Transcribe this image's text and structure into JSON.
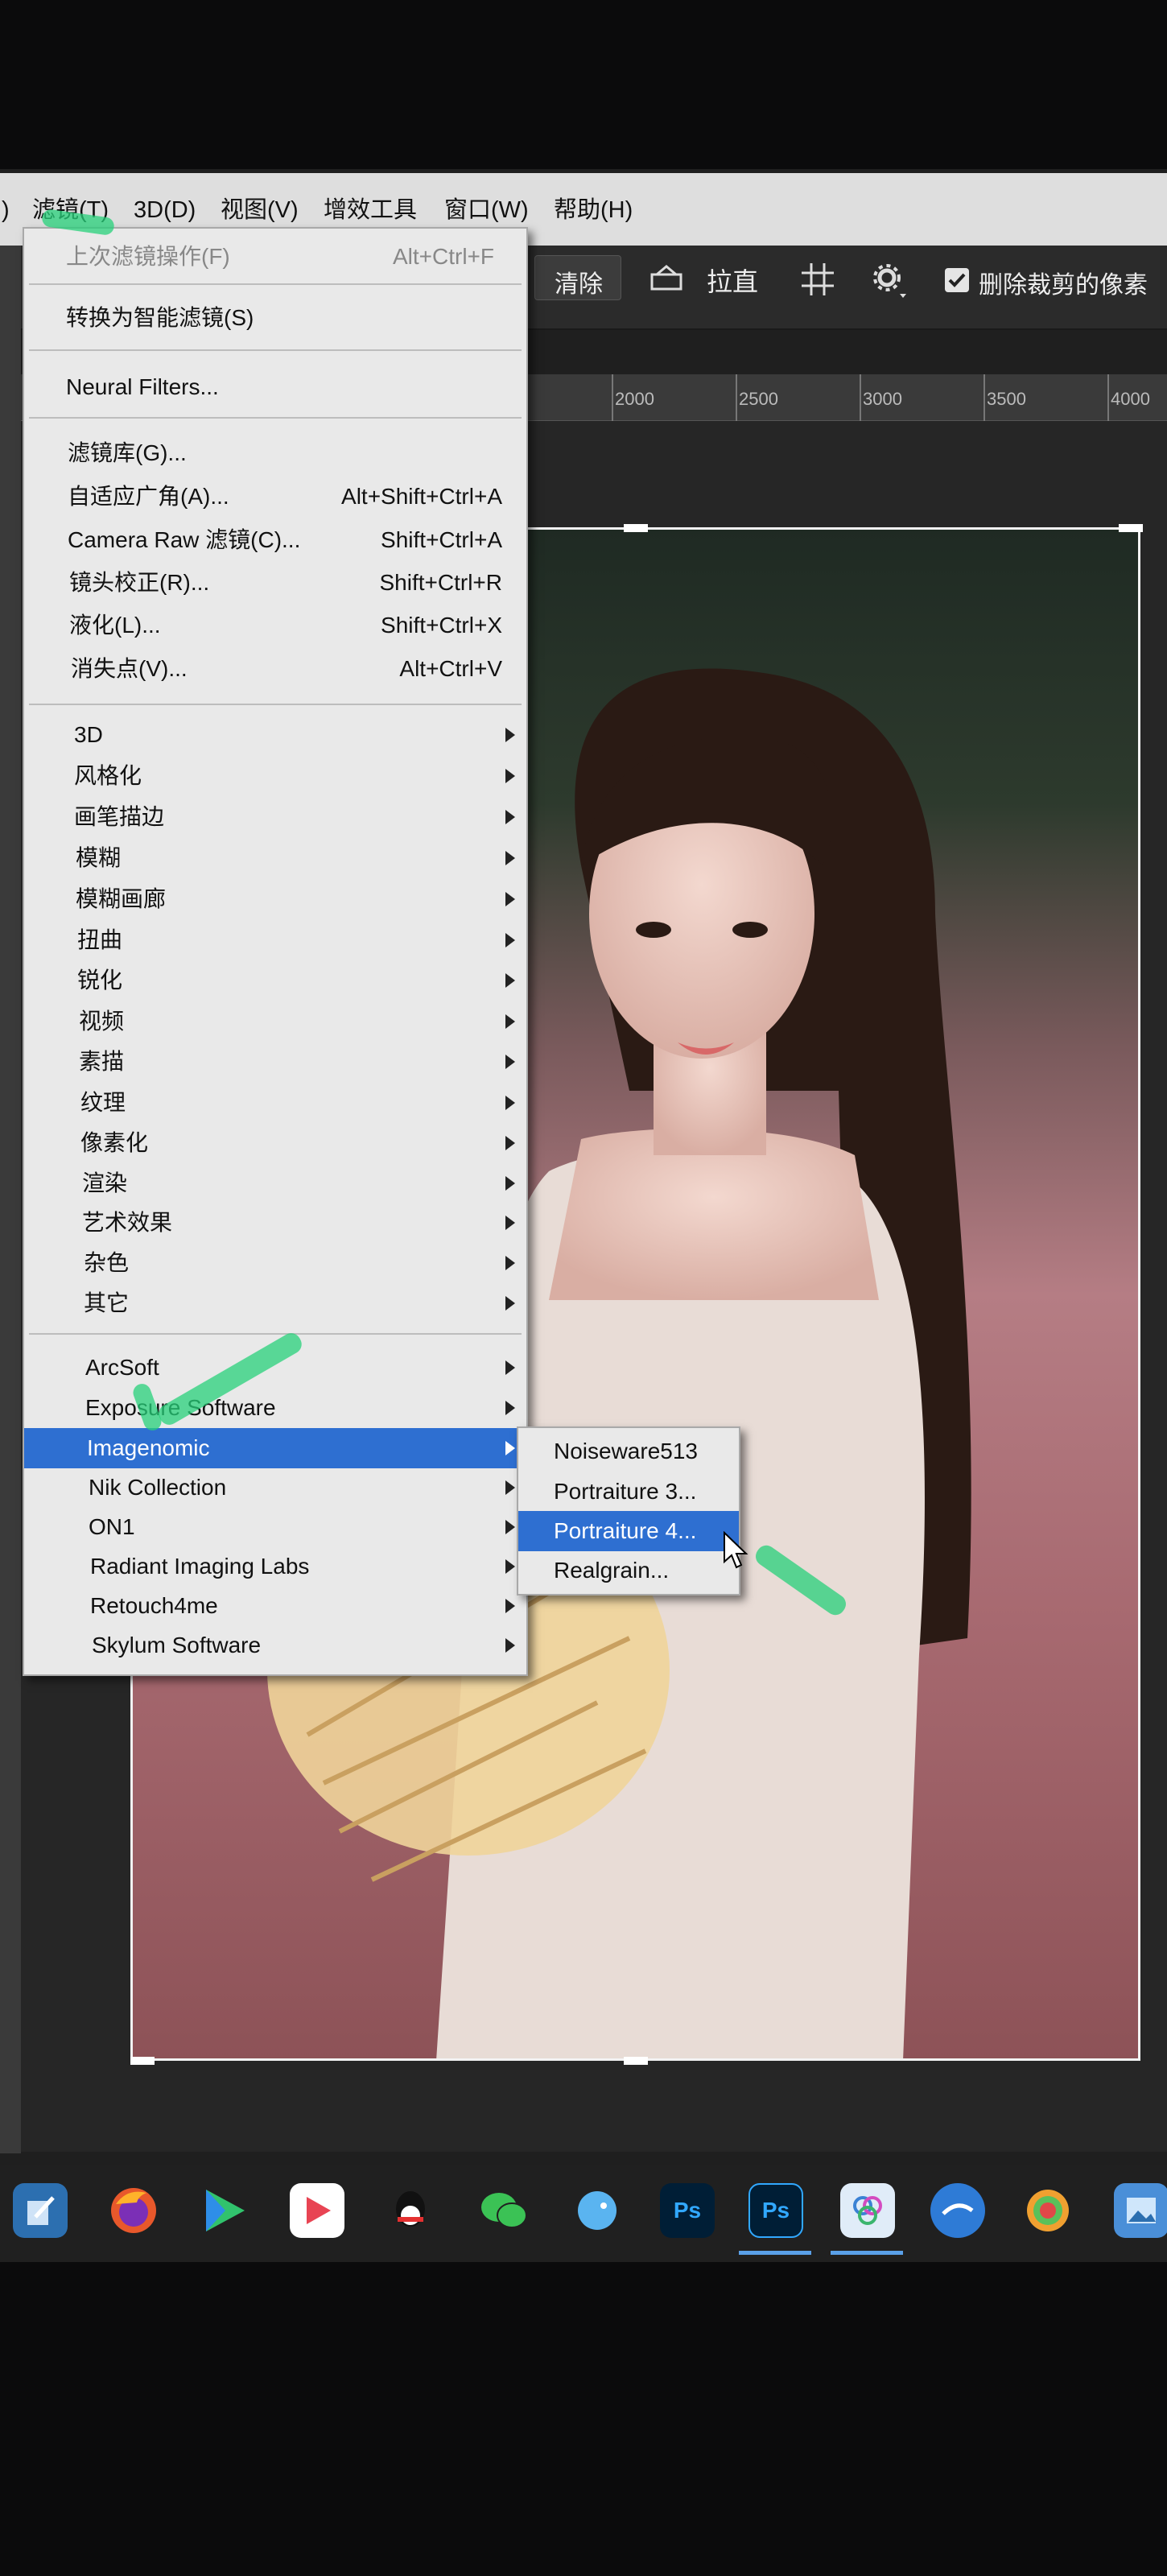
{
  "menubar": {
    "items": [
      {
        "label": ")"
      },
      {
        "label": "滤镜(T)"
      },
      {
        "label": "3D(D)"
      },
      {
        "label": "视图(V)"
      },
      {
        "label": "增效工具"
      },
      {
        "label": "窗口(W)"
      },
      {
        "label": "帮助(H)"
      }
    ]
  },
  "options_bar": {
    "clear_label": "清除",
    "straighten_label": "拉直",
    "delete_cropped_label": "删除裁剪的像素",
    "delete_cropped_checked": true,
    "left_fragment": "%"
  },
  "ruler": {
    "ticks": [
      "2000",
      "2500",
      "3000",
      "3500",
      "4000"
    ]
  },
  "filter_menu": {
    "items": [
      {
        "label": "上次滤镜操作(F)",
        "shortcut": "Alt+Ctrl+F",
        "disabled": true
      },
      {
        "label": "转换为智能滤镜(S)"
      },
      {
        "label": "Neural Filters..."
      },
      {
        "label": "滤镜库(G)..."
      },
      {
        "label": "自适应广角(A)...",
        "shortcut": "Alt+Shift+Ctrl+A"
      },
      {
        "label": "Camera Raw 滤镜(C)...",
        "shortcut": "Shift+Ctrl+A"
      },
      {
        "label": "镜头校正(R)...",
        "shortcut": "Shift+Ctrl+R"
      },
      {
        "label": "液化(L)...",
        "shortcut": "Shift+Ctrl+X"
      },
      {
        "label": "消失点(V)...",
        "shortcut": "Alt+Ctrl+V"
      },
      {
        "label": "3D",
        "submenu": true
      },
      {
        "label": "风格化",
        "submenu": true
      },
      {
        "label": "画笔描边",
        "submenu": true
      },
      {
        "label": "模糊",
        "submenu": true
      },
      {
        "label": "模糊画廊",
        "submenu": true
      },
      {
        "label": "扭曲",
        "submenu": true
      },
      {
        "label": "锐化",
        "submenu": true
      },
      {
        "label": "视频",
        "submenu": true
      },
      {
        "label": "素描",
        "submenu": true
      },
      {
        "label": "纹理",
        "submenu": true
      },
      {
        "label": "像素化",
        "submenu": true
      },
      {
        "label": "渲染",
        "submenu": true
      },
      {
        "label": "艺术效果",
        "submenu": true
      },
      {
        "label": "杂色",
        "submenu": true
      },
      {
        "label": "其它",
        "submenu": true
      },
      {
        "label": "ArcSoft",
        "submenu": true
      },
      {
        "label": "Exposure Software",
        "submenu": true
      },
      {
        "label": "Imagenomic",
        "submenu": true,
        "highlighted": true
      },
      {
        "label": "Nik Collection",
        "submenu": true
      },
      {
        "label": "ON1",
        "submenu": true
      },
      {
        "label": "Radiant Imaging Labs",
        "submenu": true
      },
      {
        "label": "Retouch4me",
        "submenu": true
      },
      {
        "label": "Skylum Software",
        "submenu": true
      }
    ]
  },
  "imagenomic_submenu": {
    "items": [
      {
        "label": "Noiseware513"
      },
      {
        "label": "Portraiture 3..."
      },
      {
        "label": "Portraiture 4...",
        "highlighted": true
      },
      {
        "label": "Realgrain..."
      }
    ]
  },
  "taskbar": {
    "ps_label_1": "Ps",
    "ps_label_2": "Ps"
  },
  "colors": {
    "menu_highlight": "#2e6fd1",
    "menu_bg": "#e9e9e9",
    "annotation_green": "#27d07a"
  }
}
